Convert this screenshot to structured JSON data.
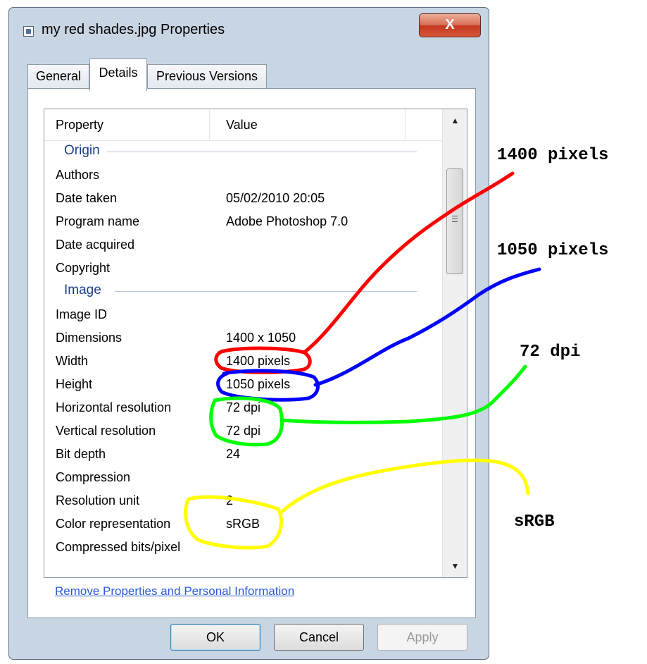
{
  "window": {
    "title": "my red shades.jpg Properties",
    "close_label": "X"
  },
  "tabs": [
    {
      "label": "General"
    },
    {
      "label": "Details"
    },
    {
      "label": "Previous Versions"
    }
  ],
  "list": {
    "header": {
      "property": "Property",
      "value": "Value"
    },
    "groups": {
      "origin": "Origin",
      "image": "Image"
    },
    "origin_rows": [
      {
        "property": "Authors",
        "value": ""
      },
      {
        "property": "Date taken",
        "value": "05/02/2010 20:05"
      },
      {
        "property": "Program name",
        "value": "Adobe Photoshop 7.0"
      },
      {
        "property": "Date acquired",
        "value": ""
      },
      {
        "property": "Copyright",
        "value": ""
      }
    ],
    "image_rows": [
      {
        "property": "Image ID",
        "value": ""
      },
      {
        "property": "Dimensions",
        "value": "1400 x 1050"
      },
      {
        "property": "Width",
        "value": "1400 pixels"
      },
      {
        "property": "Height",
        "value": "1050 pixels"
      },
      {
        "property": "Horizontal resolution",
        "value": "72 dpi"
      },
      {
        "property": "Vertical resolution",
        "value": "72 dpi"
      },
      {
        "property": "Bit depth",
        "value": "24"
      },
      {
        "property": "Compression",
        "value": ""
      },
      {
        "property": "Resolution unit",
        "value": "2"
      },
      {
        "property": "Color representation",
        "value": "sRGB"
      },
      {
        "property": "Compressed bits/pixel",
        "value": ""
      }
    ],
    "scroll_up_glyph": "▲",
    "scroll_down_glyph": "▼"
  },
  "remove_link": "Remove Properties and Personal Information",
  "buttons": {
    "ok": "OK",
    "cancel": "Cancel",
    "apply": "Apply"
  },
  "annotations": {
    "width": "1400 pixels",
    "height": "1050 pixels",
    "resolution": "72 dpi",
    "color": "sRGB",
    "colors": {
      "width": "#ff0000",
      "height": "#0000ff",
      "resolution": "#00ff00",
      "color": "#ffff00"
    }
  }
}
